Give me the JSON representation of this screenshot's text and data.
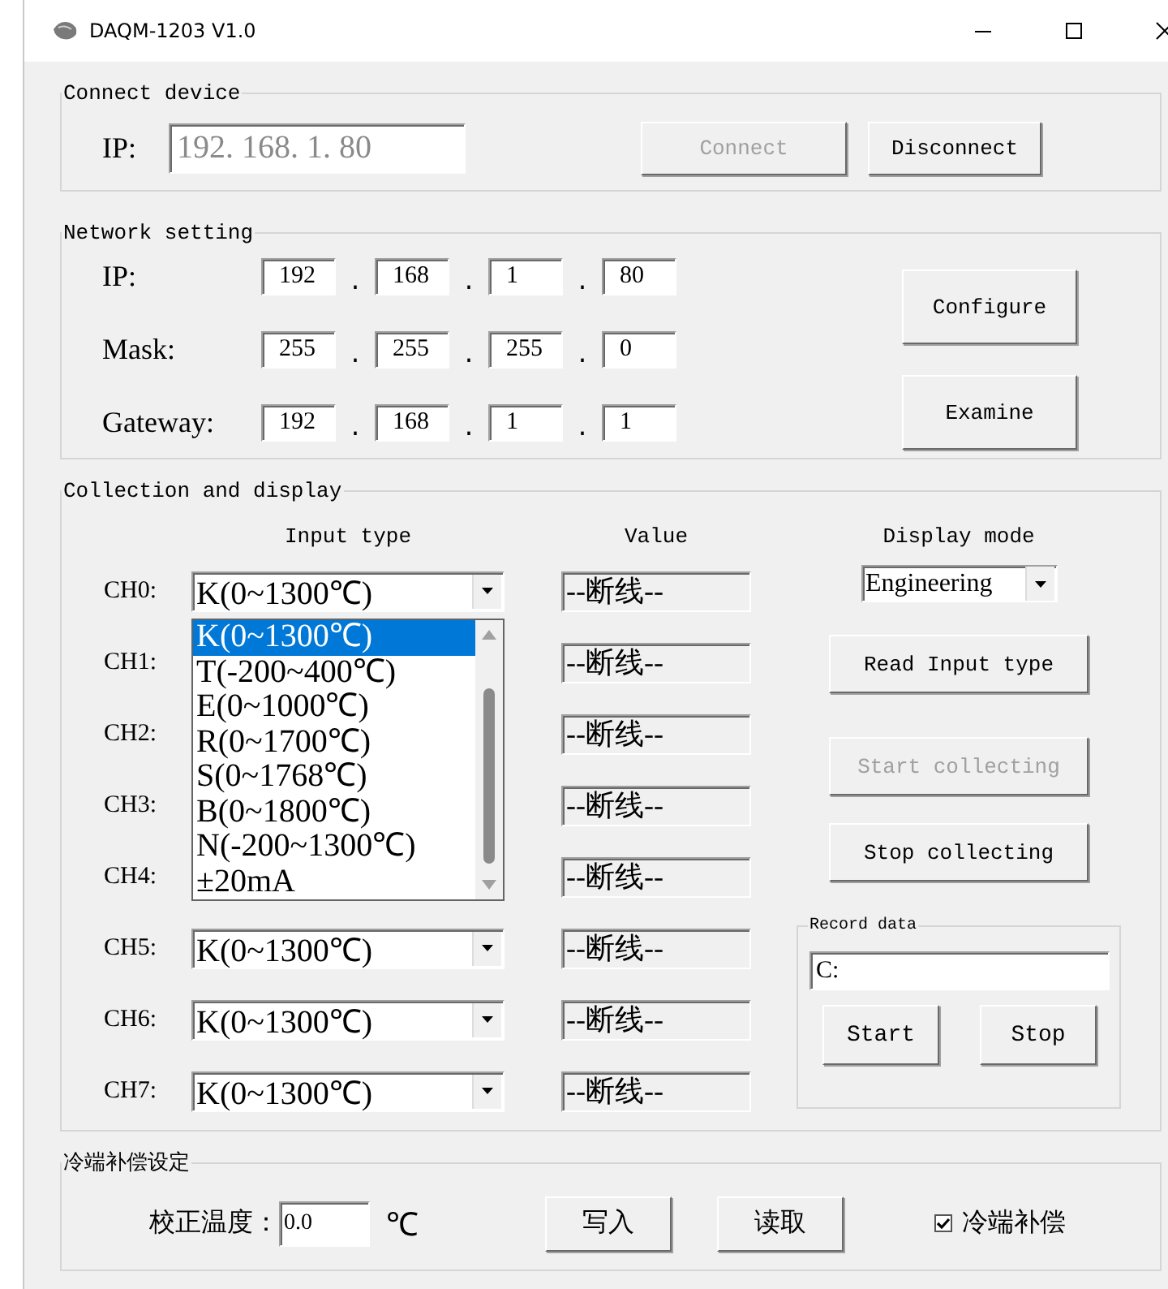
{
  "window": {
    "title": "DAQM-1203 V1.0"
  },
  "connect_device": {
    "title": "Connect device",
    "ip_label": "IP:",
    "ip": {
      "value": "192. 168. 1. 80",
      "disabled": true
    },
    "buttons": [
      {
        "label": "Connect",
        "disabled": true
      },
      {
        "label": "Disconnect",
        "disabled": false
      }
    ]
  },
  "network_setting": {
    "title": "Network setting",
    "rows": [
      {
        "label": "IP:",
        "octets": [
          "192",
          "168",
          "1",
          "80"
        ]
      },
      {
        "label": "Mask:",
        "octets": [
          "255",
          "255",
          "255",
          "0"
        ]
      },
      {
        "label": "Gateway:",
        "octets": [
          "192",
          "168",
          "1",
          "1"
        ]
      }
    ],
    "separators": ".",
    "buttons": [
      {
        "label": "Configure",
        "disabled": false
      },
      {
        "label": "Examine",
        "disabled": false
      }
    ]
  },
  "collection": {
    "title": "Collection and display",
    "input_type_header": "Input type",
    "value_header": "Value",
    "display_mode_header": "Display mode",
    "display_mode": {
      "value": "Engineering"
    },
    "channels": [
      {
        "label": "CH0:",
        "input_type": "K(0~1300℃)",
        "value": "--断线--"
      },
      {
        "label": "CH1:",
        "value": "--断线--"
      },
      {
        "label": "CH2:",
        "value": "--断线--"
      },
      {
        "label": "CH3:",
        "value": "--断线--"
      },
      {
        "label": "CH4:",
        "value": "--断线--"
      },
      {
        "label": "CH5:",
        "input_type": "K(0~1300℃)",
        "value": "--断线--"
      },
      {
        "label": "CH6:",
        "input_type": "K(0~1300℃)",
        "value": "--断线--"
      },
      {
        "label": "CH7:",
        "input_type": "K(0~1300℃)",
        "value": "--断线--"
      }
    ],
    "dropdown": {
      "options": [
        {
          "label": "K(0~1300℃)",
          "selected": true
        },
        {
          "label": "T(-200~400℃)",
          "selected": false
        },
        {
          "label": "E(0~1000℃)",
          "selected": false
        },
        {
          "label": "R(0~1700℃)",
          "selected": false
        },
        {
          "label": "S(0~1768℃)",
          "selected": false
        },
        {
          "label": "B(0~1800℃)",
          "selected": false
        },
        {
          "label": "N(-200~1300℃)",
          "selected": false
        },
        {
          "label": "±20mA",
          "selected": false
        }
      ]
    },
    "buttons": [
      {
        "label": "Read Input type",
        "disabled": false
      },
      {
        "label": "Start collecting",
        "disabled": true
      },
      {
        "label": "Stop collecting",
        "disabled": false
      }
    ],
    "record": {
      "title": "Record data",
      "path": {
        "value": "C:"
      },
      "buttons": [
        {
          "label": "Start",
          "disabled": false
        },
        {
          "label": "Stop",
          "disabled": false
        }
      ]
    }
  },
  "cold_junction": {
    "title": "冷端补偿设定",
    "temp_label": "校正温度：",
    "temp": {
      "value": "0.0"
    },
    "unit": "℃",
    "buttons": [
      {
        "label": "写入",
        "disabled": false
      },
      {
        "label": "读取",
        "disabled": false
      }
    ],
    "checkbox": {
      "label": "冷端补偿",
      "checked": true
    }
  }
}
